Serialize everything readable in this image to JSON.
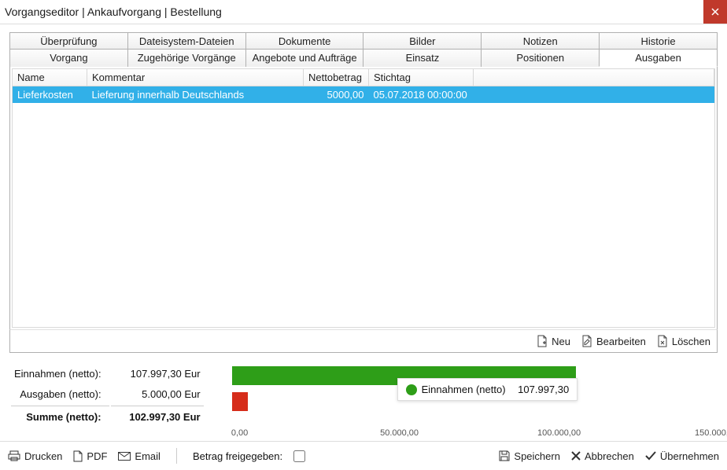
{
  "window": {
    "title": "Vorgangseditor | Ankaufvorgang | Bestellung"
  },
  "tabs_row1": [
    "Überprüfung",
    "Dateisystem-Dateien",
    "Dokumente",
    "Bilder",
    "Notizen",
    "Historie"
  ],
  "tabs_row2": [
    "Vorgang",
    "Zugehörige Vorgänge",
    "Angebote und Aufträge",
    "Einsatz",
    "Positionen",
    "Ausgaben"
  ],
  "active_tab": "Ausgaben",
  "grid": {
    "cols": [
      "Name",
      "Kommentar",
      "Nettobetrag",
      "Stichtag"
    ],
    "rows": [
      {
        "name": "Lieferkosten",
        "kommentar": "Lieferung innerhalb Deutschlands",
        "netto": "5000,00",
        "stichtag": "05.07.2018 00:00:00",
        "selected": true
      }
    ]
  },
  "rowtoolbar": {
    "neu": "Neu",
    "bearbeiten": "Bearbeiten",
    "loeschen": "Löschen"
  },
  "summary": {
    "einnahmen_label": "Einnahmen (netto):",
    "einnahmen_value": "107.997,30 Eur",
    "ausgaben_label": "Ausgaben (netto):",
    "ausgaben_value": "5.000,00 Eur",
    "summe_label": "Summe (netto):",
    "summe_value": "102.997,30 Eur"
  },
  "footer": {
    "drucken": "Drucken",
    "pdf": "PDF",
    "email": "Email",
    "freigegeben_label": "Betrag freigegeben:",
    "freigegeben_checked": false,
    "speichern": "Speichern",
    "abbrechen": "Abbrechen",
    "uebernehmen": "Übernehmen"
  },
  "chart_data": {
    "type": "bar",
    "title": "",
    "categories": [
      "Einnahmen (netto)",
      "Ausgaben (netto)"
    ],
    "values": [
      107997.3,
      5000.0
    ],
    "xlabel": "",
    "ylabel": "",
    "ticks": [
      "0,00",
      "50.000,00",
      "100.000,00",
      "150.000,00"
    ],
    "colors": [
      "#2e9e18",
      "#d62c1a"
    ],
    "xlim": [
      0,
      150000
    ],
    "tooltip": {
      "label": "Einnahmen (netto)",
      "value": "107.997,30"
    }
  }
}
